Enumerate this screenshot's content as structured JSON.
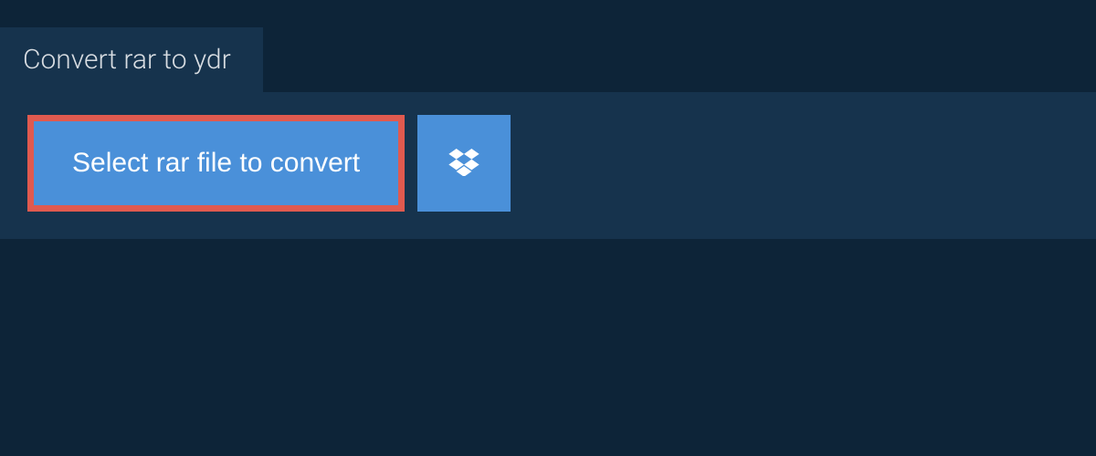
{
  "tab": {
    "title": "Convert rar to ydr"
  },
  "actions": {
    "select_file_label": "Select rar file to convert"
  }
}
